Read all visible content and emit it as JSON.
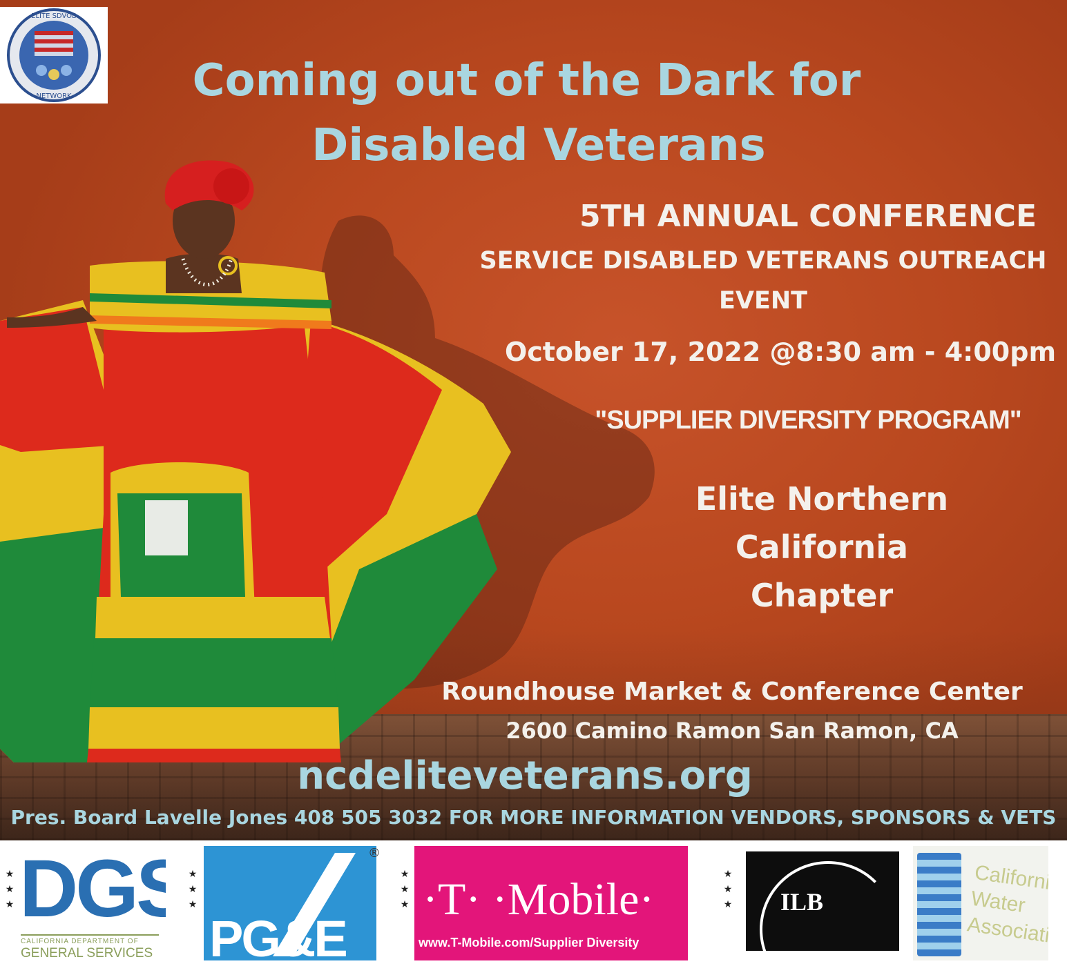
{
  "header": {
    "title_line1": "Coming out of the Dark for",
    "title_line2": "Disabled Veterans"
  },
  "event": {
    "conference": "5TH ANNUAL CONFERENCE",
    "subtitle_line1": "SERVICE DISABLED VETERANS OUTREACH",
    "subtitle_line2": "EVENT",
    "datetime": "October 17, 2022 @8:30 am - 4:00pm",
    "program": "\"SUPPLIER DIVERSITY PROGRAM\""
  },
  "chapter": {
    "line1": "Elite Northern",
    "line2": "California",
    "line3": "Chapter"
  },
  "venue": {
    "name": "Roundhouse Market & Conference Center",
    "address": "2600 Camino Ramon San Ramon, CA"
  },
  "website": "ncdeliteveterans.org",
  "contact": "Pres. Board Lavelle Jones 408 505 3032 FOR MORE INFORMATION VENDORS, SPONSORS & VETS",
  "seal": {
    "ring_top": "ELITE SDVOB",
    "ring_bottom": "NETWORK"
  },
  "sponsors": {
    "dgs": {
      "mark": "DGS",
      "line1": "CALIFORNIA DEPARTMENT OF",
      "line2": "GENERAL SERVICES"
    },
    "pge": {
      "mark": "PG&E",
      "registered": "®"
    },
    "tmobile": {
      "mark": "·T· ·Mobile·",
      "url": "www.T-Mobile.com/Supplier Diversity"
    },
    "ilb": {
      "mark": "ILB"
    },
    "cwa": {
      "line1": "California",
      "line2": "Water",
      "line3": "Association"
    },
    "stars": "★\n★\n★"
  },
  "colors": {
    "title": "#a9d6e0",
    "body_text": "#f4f1ec",
    "wall": "#b9481f",
    "pge_blue": "#2d94d4",
    "tmobile_magenta": "#e3157a",
    "dgs_blue": "#2a6fb2"
  }
}
